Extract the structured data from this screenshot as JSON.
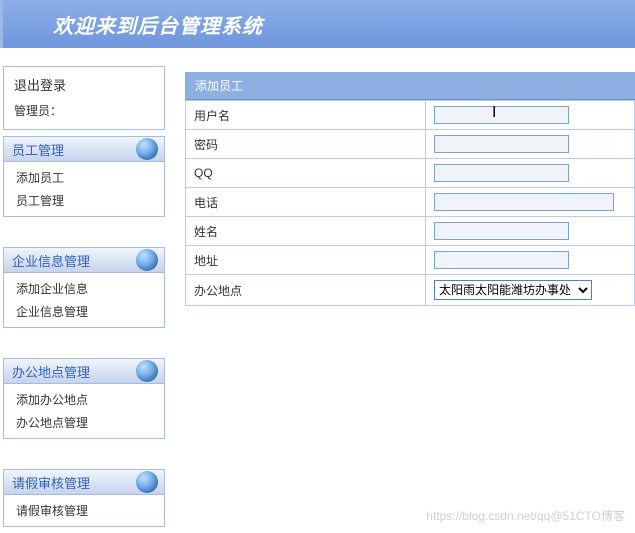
{
  "header": {
    "title": "欢迎来到后台管理系统"
  },
  "sidebar": {
    "logout": "退出登录",
    "admin": "管理员：",
    "groups": [
      {
        "title": "员工管理",
        "items": [
          "添加员工",
          "员工管理"
        ]
      },
      {
        "title": "企业信息管理",
        "items": [
          "添加企业信息",
          "企业信息管理"
        ]
      },
      {
        "title": "办公地点管理",
        "items": [
          "添加办公地点",
          "办公地点管理"
        ]
      },
      {
        "title": "请假审核管理",
        "items": [
          "请假审核管理"
        ]
      }
    ]
  },
  "form": {
    "title": "添加员工",
    "fields": [
      {
        "label": "用户名",
        "type": "text"
      },
      {
        "label": "密码",
        "type": "text"
      },
      {
        "label": "QQ",
        "type": "text"
      },
      {
        "label": "电话",
        "type": "text",
        "wide": true
      },
      {
        "label": "姓名",
        "type": "text"
      },
      {
        "label": "地址",
        "type": "text"
      },
      {
        "label": "办公地点",
        "type": "select",
        "value": "太阳雨太阳能潍坊办事处"
      }
    ]
  },
  "watermark": "https://blog.csdn.net/qq@51CTO博客"
}
